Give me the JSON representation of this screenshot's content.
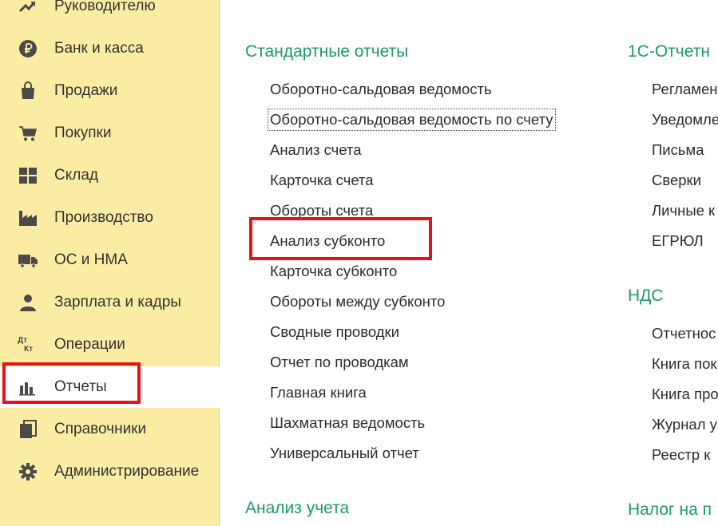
{
  "sidebar": {
    "items": [
      {
        "label": "Руководителю",
        "icon": "trend-up-icon"
      },
      {
        "label": "Банк и касса",
        "icon": "ruble-icon"
      },
      {
        "label": "Продажи",
        "icon": "shopping-bag-icon"
      },
      {
        "label": "Покупки",
        "icon": "shopping-cart-icon"
      },
      {
        "label": "Склад",
        "icon": "warehouse-grid-icon"
      },
      {
        "label": "Производство",
        "icon": "factory-icon"
      },
      {
        "label": "ОС и НМА",
        "icon": "truck-icon"
      },
      {
        "label": "Зарплата и кадры",
        "icon": "person-icon"
      },
      {
        "label": "Операции",
        "icon": "debit-credit-icon",
        "icon_text_top": "Дт",
        "icon_text_bottom": "Кт"
      },
      {
        "label": "Отчеты",
        "icon": "bar-chart-icon",
        "active": true
      },
      {
        "label": "Справочники",
        "icon": "books-icon"
      },
      {
        "label": "Администрирование",
        "icon": "gear-icon"
      }
    ]
  },
  "main": {
    "left_column": {
      "title": "Стандартные отчеты",
      "items": [
        "Оборотно-сальдовая ведомость",
        "Оборотно-сальдовая ведомость по счету",
        "Анализ счета",
        "Карточка счета",
        "Обороты счета",
        "Анализ субконто",
        "Карточка субконто",
        "Обороты между субконто",
        "Сводные проводки",
        "Отчет по проводкам",
        "Главная книга",
        "Шахматная ведомость",
        "Универсальный отчет"
      ],
      "bottom_title": "Анализ учета"
    },
    "right_column": {
      "title": "1С-Отчетн",
      "items": [
        "Регламен",
        "Уведомле",
        "Письма",
        "Сверки",
        "Личные к",
        "ЕГРЮЛ"
      ],
      "section2_title": "НДС",
      "section2_items": [
        "Отчетнос",
        "Книга пок",
        "Книга про",
        "Журнал у",
        "Реестр к"
      ],
      "bottom_title": "Налог на п"
    }
  },
  "colors": {
    "sidebar_bg": "#fbeca4",
    "section_title": "#1d9a6c",
    "highlight": "#e8101a",
    "icon": "#4a4a4a"
  }
}
